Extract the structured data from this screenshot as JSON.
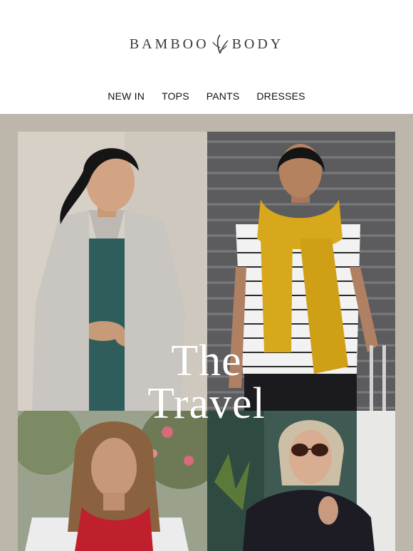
{
  "brand": {
    "left_word": "BAMBOO",
    "right_word": "BODY",
    "logo_icon": "bamboo-leaf-icon"
  },
  "nav": {
    "items": [
      {
        "label": "NEW IN"
      },
      {
        "label": "TOPS"
      },
      {
        "label": "PANTS"
      },
      {
        "label": "DRESSES"
      }
    ]
  },
  "hero": {
    "title_line1": "The",
    "title_line2": "Travel",
    "background_color": "#bdb6ab"
  },
  "colors": {
    "scarf_grey": "#c9c5c0",
    "scarf_mustard": "#d8a81c",
    "scarf_red": "#c0202e",
    "scarf_black": "#1d1c24",
    "top_teal": "#2f5d5c"
  }
}
